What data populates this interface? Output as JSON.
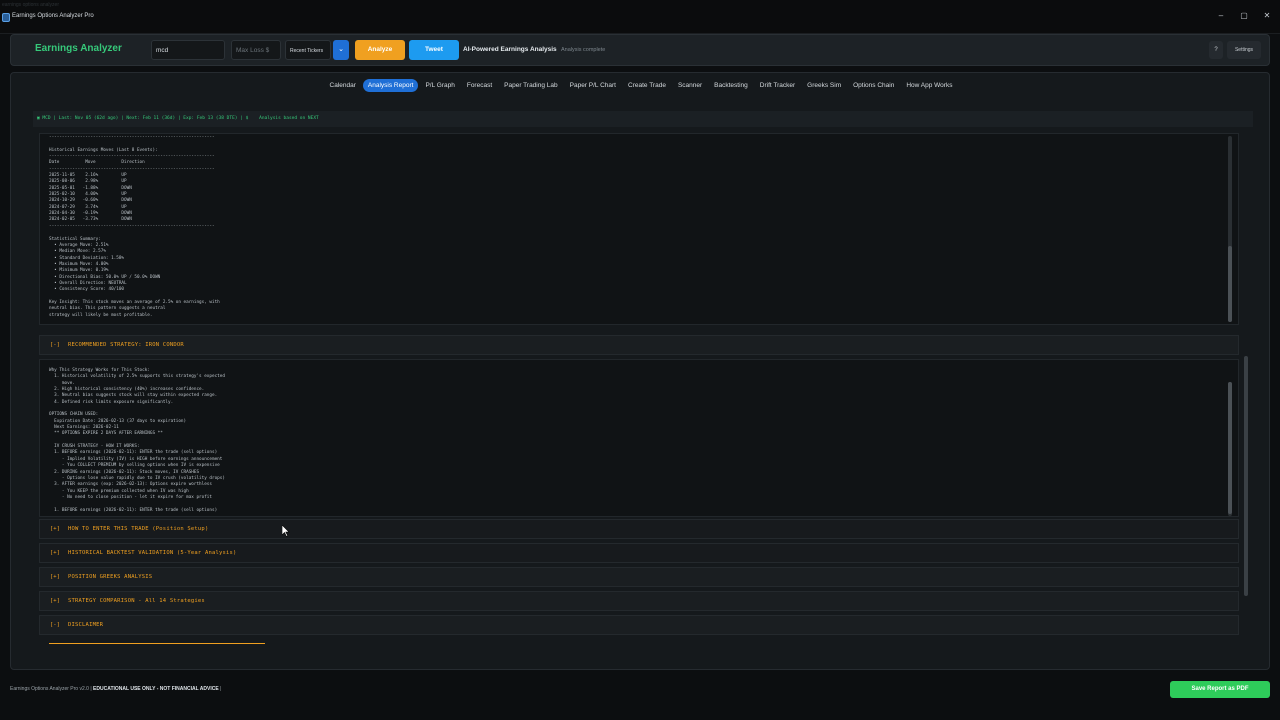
{
  "window": {
    "title": "Earnings Options Analyzer Pro",
    "ghost_text": "earnings options analyzer"
  },
  "header": {
    "brand": "Earnings Analyzer",
    "ticker_value": "mcd",
    "max_loss_placeholder": "Max Loss $",
    "recent_tickers_label": "Recent Tickers",
    "analyze_label": "Analyze",
    "tweet_label": "Tweet",
    "ai_title": "AI-Powered Earnings Analysis",
    "ai_status": "Analysis complete",
    "help_label": "?",
    "settings_label": "Settings"
  },
  "tabs": [
    {
      "label": "Calendar"
    },
    {
      "label": "Analysis Report",
      "active": true
    },
    {
      "label": "P/L Graph"
    },
    {
      "label": "Forecast"
    },
    {
      "label": "Paper Trading Lab"
    },
    {
      "label": "Paper P/L Chart"
    },
    {
      "label": "Create Trade"
    },
    {
      "label": "Scanner"
    },
    {
      "label": "Backtesting"
    },
    {
      "label": "Drift Tracker"
    },
    {
      "label": "Greeks Sim"
    },
    {
      "label": "Options Chain"
    },
    {
      "label": "How App Works"
    }
  ],
  "infobar": "▣ MCD | Last: Nov 05 (62d ago) | Next: Feb 11 (36d) | Exp: Feb 13 (38 DTE) | $    Analysis based on NEXT",
  "history_panel": "----------------------------------------------------------------\n\nHistorical Earnings Moves (Last 8 Events):\n----------------------------------------------------------------\nDate          Move          Direction\n----------------------------------------------------------------\n2025-11-05    2.16%         UP\n2025-08-06    2.98%         UP\n2025-05-01   -1.88%         DOWN\n2025-02-10    4.00%         UP\n2024-10-29   -0.60%         DOWN\n2024-07-29    3.74%         UP\n2024-04-30   -0.19%         DOWN\n2024-02-05   -3.73%         DOWN\n----------------------------------------------------------------\n\nStatistical Summary:\n  • Average Move: 2.51%\n  • Median Move: 2.57%\n  • Standard Deviation: 1.58%\n  • Maximum Move: 4.00%\n  • Minimum Move: 0.19%\n  • Directional Bias: 50.0% UP / 50.0% DOWN\n  • Overall Direction: NEUTRAL\n  • Consistency Score: 40/100\n\nKey Insight: This stock moves an average of 2.5% on earnings, with\nneutral bias. This pattern suggests a neutral\nstrategy will likely be most profitable.",
  "strategy_section": {
    "toggle": "[-]",
    "label": "RECOMMENDED STRATEGY: IRON CONDOR"
  },
  "strategy_panel": "Why This Strategy Works for This Stock:\n  1. Historical volatility of 2.5% supports this strategy's expected\n     move.\n  2. High historical consistency (40%) increases confidence.\n  3. Neutral bias suggests stock will stay within expected range.\n  4. Defined risk limits exposure significantly.\n\nOPTIONS CHAIN USED:\n  Expiration Date: 2026-02-13 (37 days to expiration)\n  Next Earnings: 2026-02-11\n  ** OPTIONS EXPIRE 2 DAYS AFTER EARNINGS **\n\n  IV CRUSH STRATEGY - HOW IT WORKS:\n  1. BEFORE earnings (2026-02-11): ENTER the trade (sell options)\n     - Implied Volatility (IV) is HIGH before earnings announcement\n     - You COLLECT PREMIUM by selling options when IV is expensive\n  2. DURING earnings (2026-02-11): Stock moves, IV CRASHES\n     - Options lose value rapidly due to IV crush (volatility drops)\n  3. AFTER earnings (exp: 2026-02-13): Options expire worthless\n     - You KEEP the premium collected when IV was high\n     - No need to close position - let it expire for max profit\n\n  1. BEFORE earnings (2026-02-11): ENTER the trade (sell options)",
  "sections": [
    {
      "toggle": "[+]",
      "label": "HOW TO ENTER THIS TRADE (Position Setup)"
    },
    {
      "toggle": "[+]",
      "label": "HISTORICAL BACKTEST VALIDATION (5-Year Analysis)"
    },
    {
      "toggle": "[+]",
      "label": "POSITION GREEKS ANALYSIS"
    },
    {
      "toggle": "[+]",
      "label": "STRATEGY COMPARISON - All 14 Strategies"
    },
    {
      "toggle": "[-]",
      "label": "DISCLAIMER"
    }
  ],
  "footer": {
    "version": "Earnings Options Analyzer Pro v2.0",
    "notice": "EDUCATIONAL USE ONLY - NOT FINANCIAL ADVICE",
    "separator": "|",
    "pdf_button": "Save Report as PDF"
  },
  "colors": {
    "brand_green": "#36c97a",
    "accent_orange": "#f0a020",
    "accent_blue": "#1f6fd6",
    "tweet_blue": "#1d9bf0",
    "pdf_green": "#2ecc5a"
  }
}
